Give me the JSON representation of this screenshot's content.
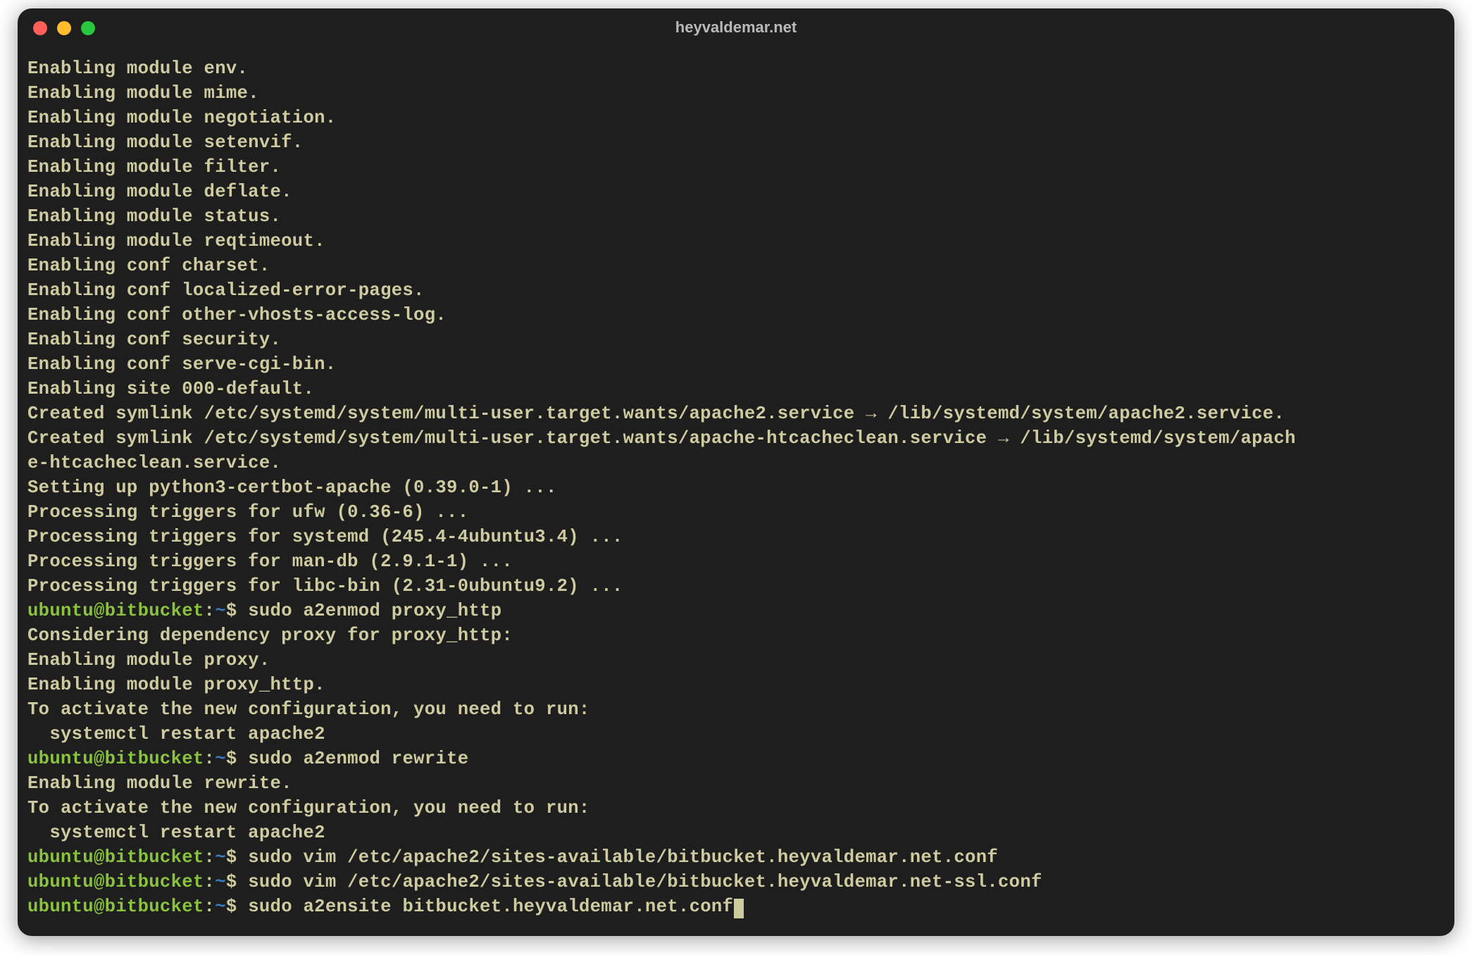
{
  "window": {
    "title": "heyvaldemar.net"
  },
  "colors": {
    "bg": "#1e1e1e",
    "output": "#cfcba0",
    "user": "#8ac33e",
    "path": "#3a7bbf"
  },
  "prompt": {
    "user_host": "ubuntu@bitbucket",
    "separator": ":",
    "path": "~",
    "symbol": "$"
  },
  "output_blocks": {
    "block1": [
      "Enabling module env.",
      "Enabling module mime.",
      "Enabling module negotiation.",
      "Enabling module setenvif.",
      "Enabling module filter.",
      "Enabling module deflate.",
      "Enabling module status.",
      "Enabling module reqtimeout.",
      "Enabling conf charset.",
      "Enabling conf localized-error-pages.",
      "Enabling conf other-vhosts-access-log.",
      "Enabling conf security.",
      "Enabling conf serve-cgi-bin.",
      "Enabling site 000-default.",
      "Created symlink /etc/systemd/system/multi-user.target.wants/apache2.service → /lib/systemd/system/apache2.service.",
      "Created symlink /etc/systemd/system/multi-user.target.wants/apache-htcacheclean.service → /lib/systemd/system/apach",
      "e-htcacheclean.service.",
      "Setting up python3-certbot-apache (0.39.0-1) ...",
      "Processing triggers for ufw (0.36-6) ...",
      "Processing triggers for systemd (245.4-4ubuntu3.4) ...",
      "Processing triggers for man-db (2.9.1-1) ...",
      "Processing triggers for libc-bin (2.31-0ubuntu9.2) ..."
    ],
    "block2": [
      "Considering dependency proxy for proxy_http:",
      "Enabling module proxy.",
      "Enabling module proxy_http.",
      "To activate the new configuration, you need to run:",
      "  systemctl restart apache2"
    ],
    "block3": [
      "Enabling module rewrite.",
      "To activate the new configuration, you need to run:",
      "  systemctl restart apache2"
    ]
  },
  "commands": {
    "cmd1": "sudo a2enmod proxy_http",
    "cmd2": "sudo a2enmod rewrite",
    "cmd3": "sudo vim /etc/apache2/sites-available/bitbucket.heyvaldemar.net.conf",
    "cmd4": "sudo vim /etc/apache2/sites-available/bitbucket.heyvaldemar.net-ssl.conf",
    "cmd5": "sudo a2ensite bitbucket.heyvaldemar.net.conf"
  }
}
